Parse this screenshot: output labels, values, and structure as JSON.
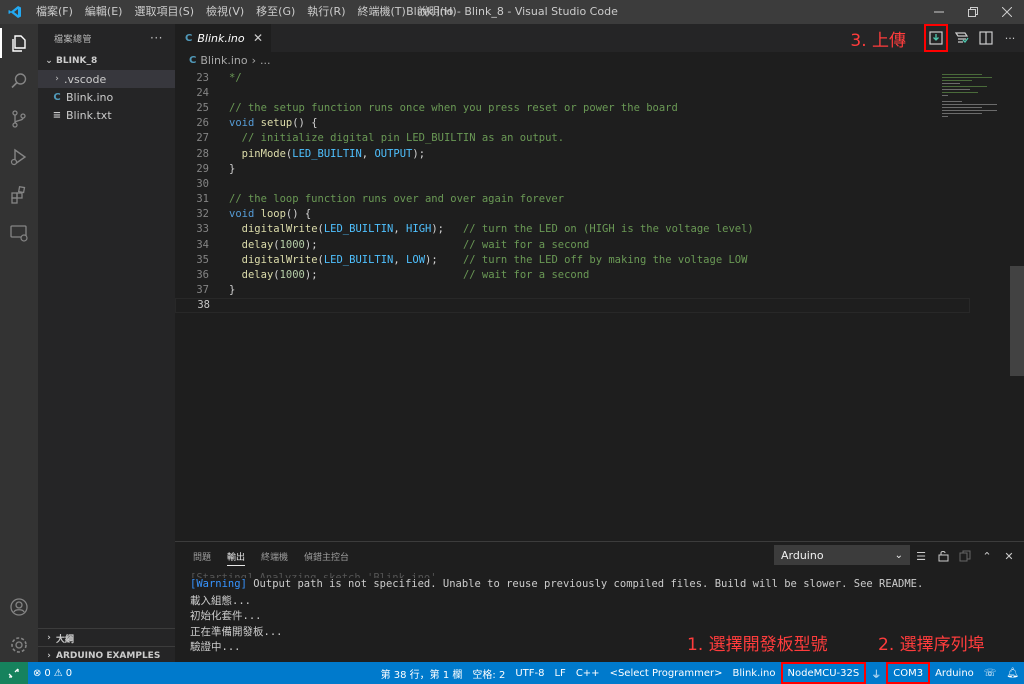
{
  "titlebar": {
    "menu": [
      "檔案(F)",
      "編輯(E)",
      "選取項目(S)",
      "檢視(V)",
      "移至(G)",
      "執行(R)",
      "終端機(T)",
      "說明(H)"
    ],
    "title": "Blink.ino - Blink_8 - Visual Studio Code"
  },
  "sidebar": {
    "header": "檔案總管",
    "more": "···",
    "folder": "BLINK_8",
    "items": [
      {
        "label": ".vscode",
        "type": "folder"
      },
      {
        "label": "Blink.ino",
        "type": "ino"
      },
      {
        "label": "Blink.txt",
        "type": "txt"
      }
    ],
    "outline": "大綱",
    "examples": "ARDUINO EXAMPLES"
  },
  "editor": {
    "tab_label": "Blink.ino",
    "breadcrumb_file": "Blink.ino",
    "breadcrumb_rest": "...",
    "lines": [
      {
        "n": "23",
        "t": "*/"
      },
      {
        "n": "24",
        "t": ""
      },
      {
        "n": "25",
        "t": "// the setup function runs once when you press reset or power the board"
      },
      {
        "n": "26",
        "t": "void setup() {"
      },
      {
        "n": "27",
        "t": "  // initialize digital pin LED_BUILTIN as an output."
      },
      {
        "n": "28",
        "t": "  pinMode(LED_BUILTIN, OUTPUT);"
      },
      {
        "n": "29",
        "t": "}"
      },
      {
        "n": "30",
        "t": ""
      },
      {
        "n": "31",
        "t": "// the loop function runs over and over again forever"
      },
      {
        "n": "32",
        "t": "void loop() {"
      },
      {
        "n": "33",
        "t": "  digitalWrite(LED_BUILTIN, HIGH);   // turn the LED on (HIGH is the voltage level)"
      },
      {
        "n": "34",
        "t": "  delay(1000);                       // wait for a second"
      },
      {
        "n": "35",
        "t": "  digitalWrite(LED_BUILTIN, LOW);    // turn the LED off by making the voltage LOW"
      },
      {
        "n": "36",
        "t": "  delay(1000);                       // wait for a second"
      },
      {
        "n": "37",
        "t": "}"
      },
      {
        "n": "38",
        "t": ""
      }
    ]
  },
  "annotations": {
    "upload": "3. 上傳",
    "board": "1. 選擇開發板型號",
    "port": "2. 選擇序列埠"
  },
  "panel": {
    "tabs": [
      "問題",
      "輸出",
      "終端機",
      "偵錯主控台"
    ],
    "active_tab": "輸出",
    "channel": "Arduino",
    "output_cut": "[Starting] Analyzing sketch 'Blink.ino'",
    "output": [
      "[Warning] Output path is not specified. Unable to reuse previously compiled files. Build will be slower. See README.",
      "載入組態...",
      "初始化套件...",
      "正在準備開發板...",
      "驗證中..."
    ]
  },
  "statusbar": {
    "errors": "0",
    "warnings": "0",
    "position": "第 38 行，第 1 欄",
    "spaces": "空格: 2",
    "encoding": "UTF-8",
    "eol": "LF",
    "language": "C++",
    "programmer": "<Select Programmer>",
    "sketch": "Blink.ino",
    "board": "NodeMCU-32S",
    "port": "COM3",
    "platform": "Arduino"
  },
  "colors": {
    "accent": "#007acc",
    "annotation": "#ff0000"
  }
}
